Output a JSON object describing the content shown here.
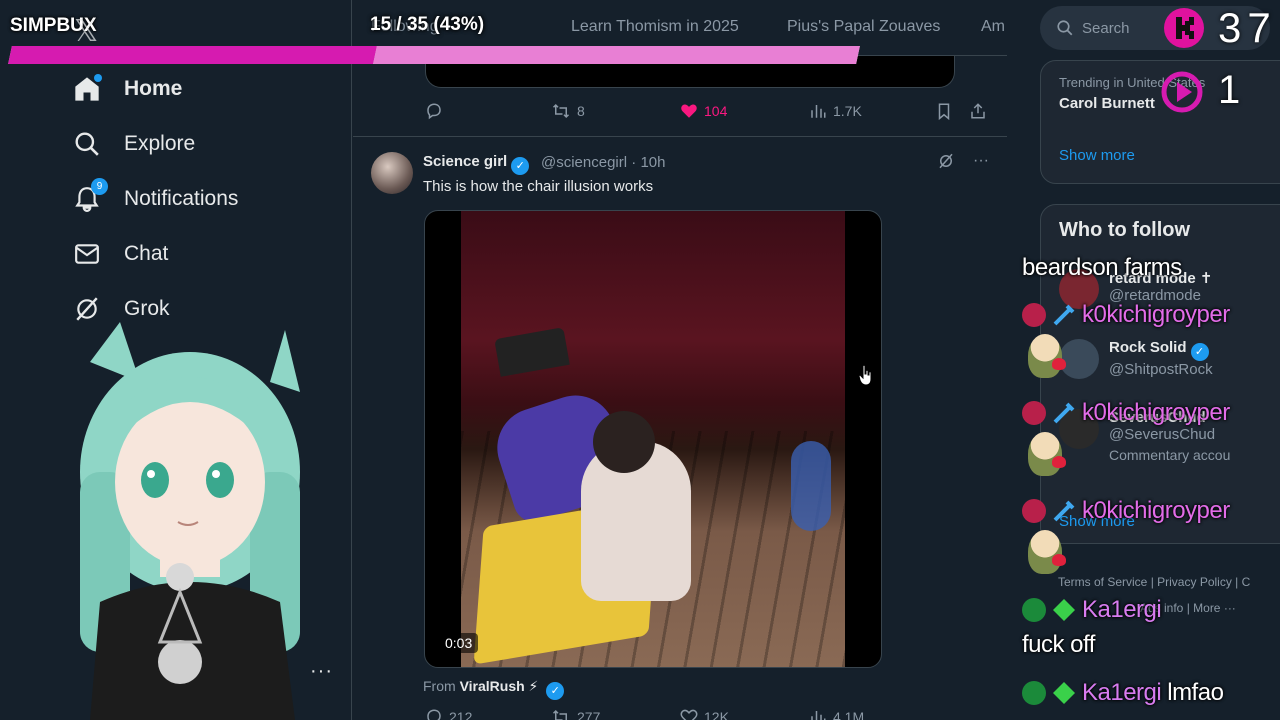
{
  "overlay": {
    "brand": "SIMPBUX",
    "progress_label": "15 / 35 (43%)",
    "progress_fraction": 0.43,
    "counter_top": "37",
    "counter_bottom": "1",
    "accent": "#d61bb0"
  },
  "sidebar": {
    "items": [
      {
        "label": "Home",
        "icon": "home-icon"
      },
      {
        "label": "Explore",
        "icon": "search-icon"
      },
      {
        "label": "Notifications",
        "icon": "bell-icon",
        "badge": "9"
      },
      {
        "label": "Chat",
        "icon": "mail-icon"
      },
      {
        "label": "Grok",
        "icon": "grok-icon"
      }
    ],
    "more": "···"
  },
  "tabs": [
    "Following",
    "Learn Thomism in 2025",
    "Pius's Papal Zouaves",
    "Am"
  ],
  "prev_tweet": {
    "retweets": "8",
    "likes": "104",
    "views": "1.7K"
  },
  "tweet": {
    "name": "Science girl",
    "handle": "@sciencegirl",
    "time": "10h",
    "text": "This is how the chair illusion works",
    "video_time": "0:03",
    "from_prefix": "From",
    "from_name": "ViralRush ⚡",
    "replies": "212",
    "retweets": "277",
    "likes": "12K",
    "views": "4.1M"
  },
  "right": {
    "search_placeholder": "Search",
    "trend_sub": "Trending in United States",
    "trend_name": "Carol Burnett",
    "show_more": "Show more",
    "wtf_title": "Who to follow",
    "follows": [
      {
        "name": "retard mode ✝",
        "handle": "@retardmode"
      },
      {
        "name": "Rock Solid",
        "handle": "@ShitpostRock"
      },
      {
        "name": "SeverusChud",
        "handle": "@SeverusChud",
        "bio": "Commentary accou"
      }
    ],
    "show_more_2": "Show more",
    "footer_1": "Terms of Service  |  Privacy Policy  |  C",
    "footer_2": "Ads info  |  More ···"
  },
  "chat": [
    {
      "text": "beardson farms"
    },
    {
      "user": "k0kichigroyper"
    },
    {
      "user": "k0kichigroyper"
    },
    {
      "user": "k0kichigroyper"
    },
    {
      "user": "Ka1ergi"
    },
    {
      "text": "fuck off"
    },
    {
      "user": "Ka1ergi",
      "text": "lmfao"
    }
  ]
}
